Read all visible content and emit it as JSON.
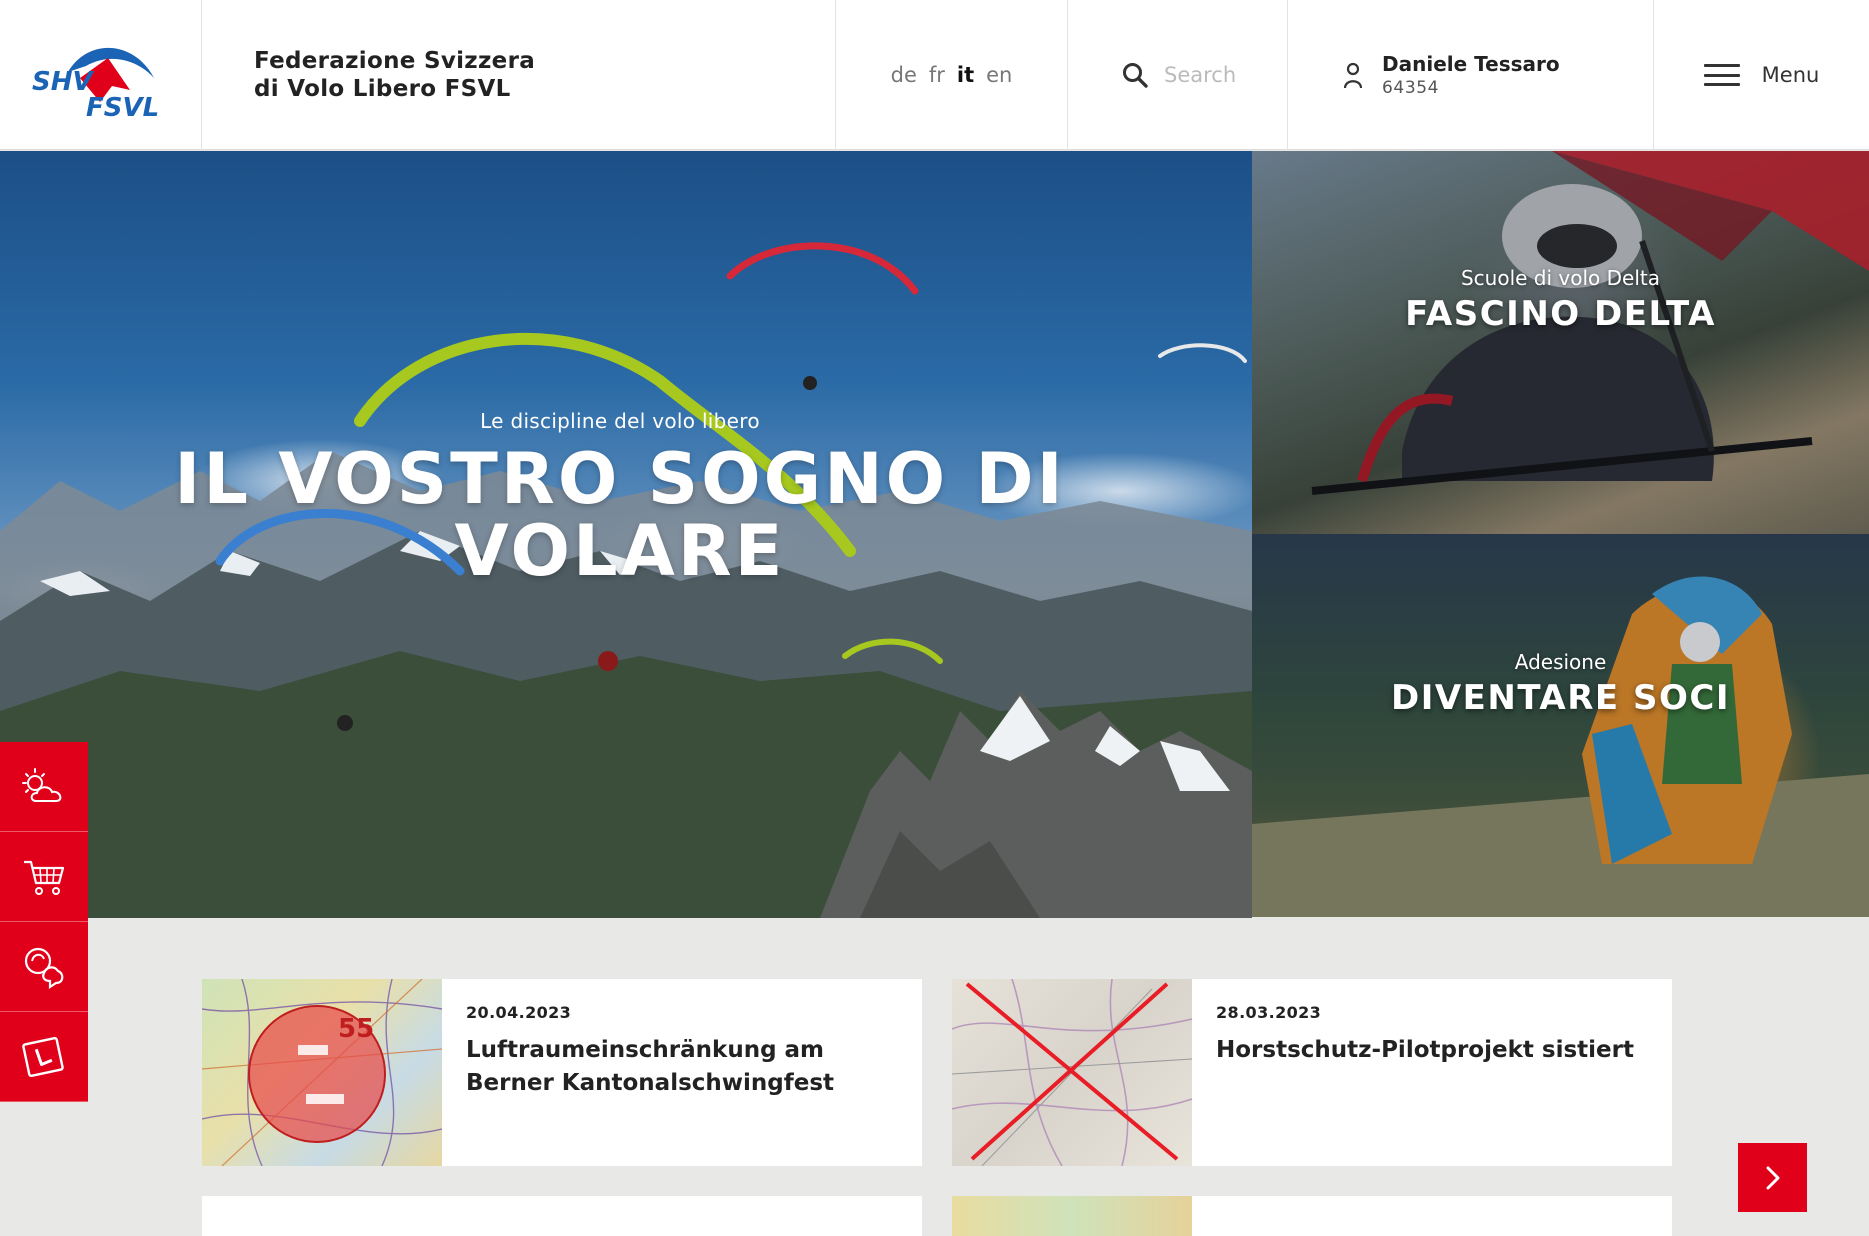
{
  "header": {
    "logo": {
      "top": "SHV",
      "bottom": "FSVL"
    },
    "org_line1": "Federazione Svizzera",
    "org_line2": "di Volo Libero FSVL",
    "languages": [
      {
        "code": "de",
        "active": false
      },
      {
        "code": "fr",
        "active": false
      },
      {
        "code": "it",
        "active": true
      },
      {
        "code": "en",
        "active": false
      }
    ],
    "search_placeholder": "Search",
    "user_name": "Daniele Tessaro",
    "user_id": "64354",
    "menu_label": "Menu"
  },
  "hero": {
    "subtitle": "Le discipline del volo libero",
    "title": "IL VOSTRO SOGNO DI VOLARE"
  },
  "tiles": [
    {
      "subtitle": "Scuole di volo Delta",
      "title": "FASCINO DELTA"
    },
    {
      "subtitle": "Adesione",
      "title": "DIVENTARE SOCI"
    }
  ],
  "sidebar_icons": [
    "weather-icon",
    "shop-cart-icon",
    "meeting-icon",
    "learner-license-icon"
  ],
  "news": [
    {
      "date": "20.04.2023",
      "title": "Luftraumeinschränkung am Berner Kantonalschwingfest"
    },
    {
      "date": "28.03.2023",
      "title": "Horstschutz-Pilotprojekt sistiert"
    }
  ],
  "colors": {
    "brand_red": "#e1001a",
    "brand_blue": "#1b63b5"
  }
}
